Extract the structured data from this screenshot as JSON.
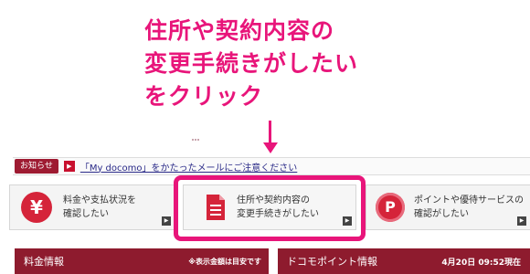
{
  "annotation": {
    "line1": "住所や契約内容の",
    "line2": "変更手続きがしたい",
    "line3": "をクリック"
  },
  "notice": {
    "label": "お知らせ",
    "link_text": "「My docomo」をかたったメールにご注意ください"
  },
  "tiles": [
    {
      "icon": "yen-icon",
      "icon_glyph": "¥",
      "line1": "料金や支払状況を",
      "line2": "確認したい"
    },
    {
      "icon": "document-icon",
      "line1": "住所や契約内容の",
      "line2": "変更手続きがしたい"
    },
    {
      "icon": "points-icon",
      "icon_glyph": "P",
      "line1": "ポイントや優待サービスの",
      "line2": "確認がしたい"
    }
  ],
  "panels": {
    "left": {
      "title": "料金情報",
      "note": "※表示金額は目安です"
    },
    "right": {
      "title": "ドコモポイント情報",
      "timestamp": "4月20日 09:52現在"
    }
  },
  "colors": {
    "accent_pink": "#e8157a",
    "brand_red": "#c8102e",
    "panel_maroon": "#8e1b2e"
  }
}
